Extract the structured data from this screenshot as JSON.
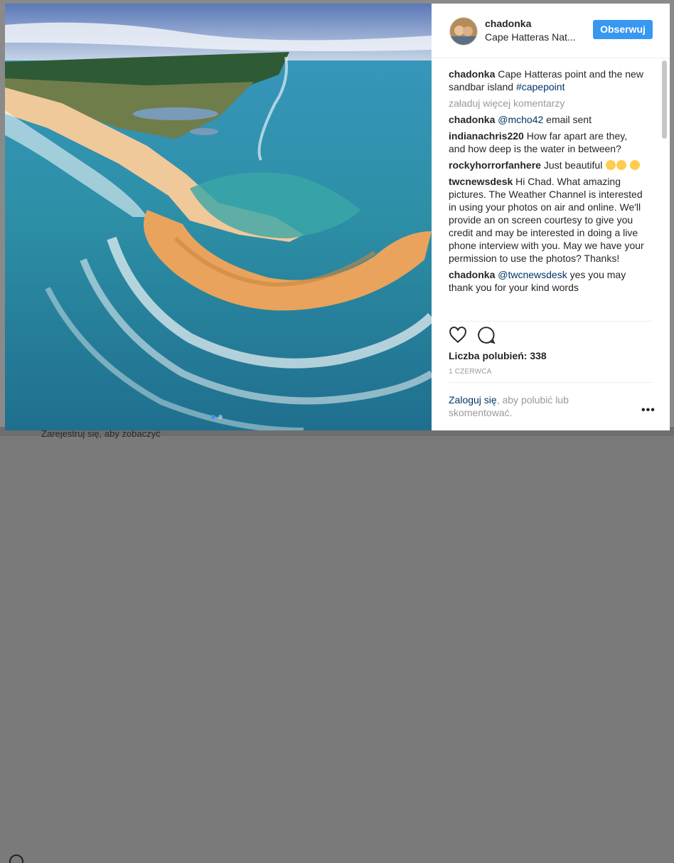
{
  "post": {
    "username": "chadonka",
    "location": "Cape Hatteras Nat...",
    "follow_label": "Obserwuj",
    "caption_text": "Cape Hatteras point and the new sandbar island",
    "caption_tag": "#capepoint",
    "load_more": "załaduj więcej komentarzy",
    "comments": [
      {
        "user": "chadonka",
        "mention": "@mcho42",
        "text": "email sent"
      },
      {
        "user": "indianachris220",
        "mention": "",
        "text": "How far apart are they, and how deep is the water in between?"
      },
      {
        "user": "rockyhorrorfanhere",
        "mention": "",
        "text": "Just beautiful"
      },
      {
        "user": "twcnewsdesk",
        "mention": "",
        "text": "Hi Chad. What amazing pictures. The Weather Channel is interested in using your photos on air and online. We'll provide an on screen courtesy to give you credit and may be interested in doing a live phone interview with you. May we have your permission to use the photos? Thanks!"
      },
      {
        "user": "chadonka",
        "mention": "@twcnewsdesk",
        "text": "yes you may thank you for your kind words"
      }
    ],
    "likes": "Liczba polubień: 338",
    "date": "1 CZERWCA",
    "login_link": "Zaloguj się",
    "login_text": ", aby polubić lub skomentować.",
    "menu": "•••"
  },
  "background": {
    "register_text": "Zarejestruj się, aby zobaczyć"
  },
  "icons": {
    "like": "heart-icon",
    "comment": "comment-icon",
    "more": "more-options-icon"
  },
  "colors": {
    "follow_button": "#3897f0",
    "link": "#003569",
    "muted": "#999999"
  }
}
